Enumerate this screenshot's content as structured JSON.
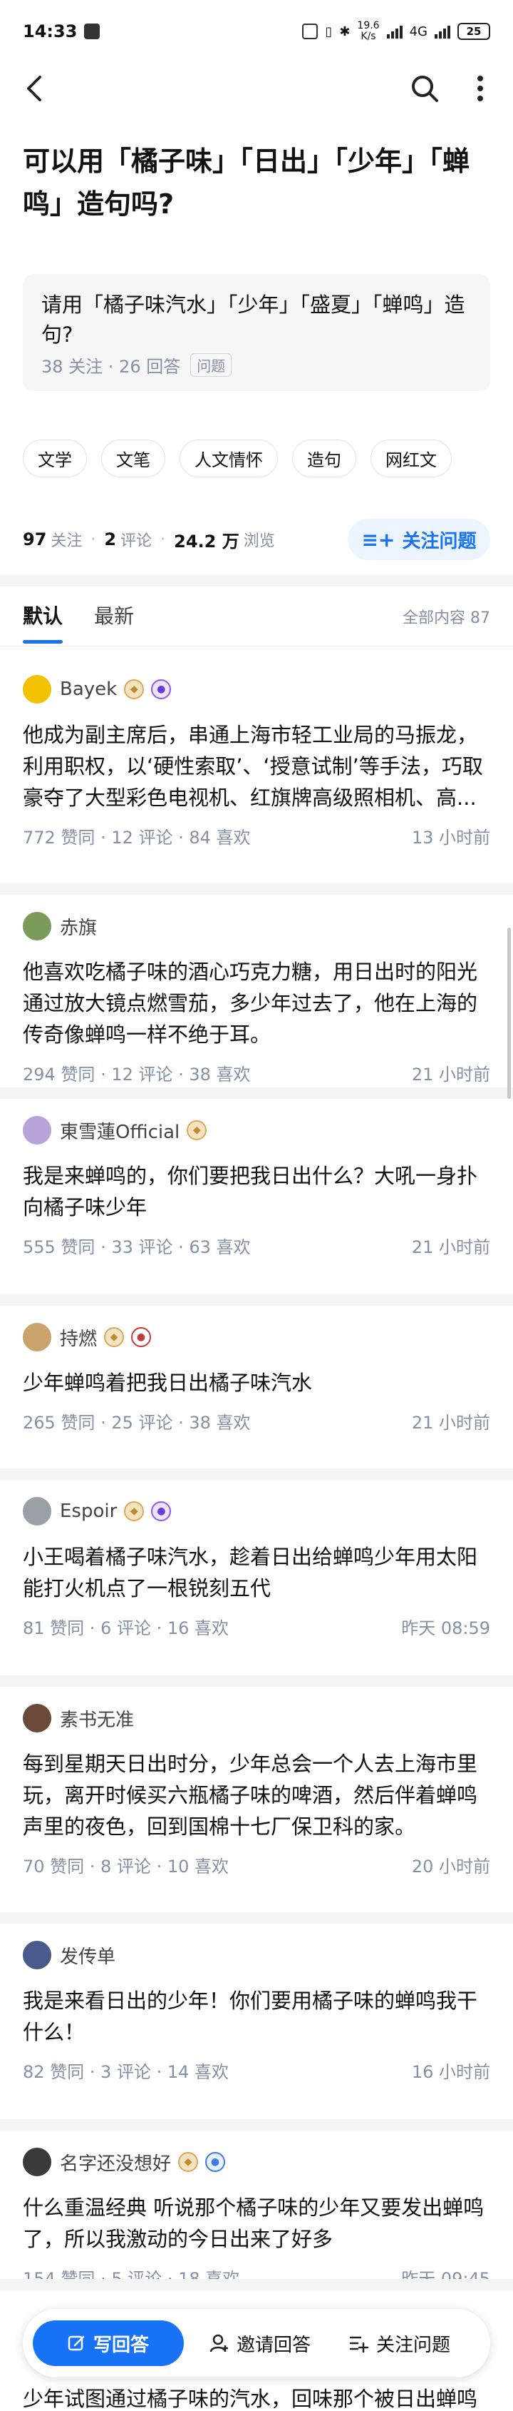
{
  "status_bar": {
    "time": "14:33",
    "net_speed_value": "19.6",
    "net_speed_unit": "K/s",
    "network": "4G",
    "battery": "25"
  },
  "question": {
    "title": "可以用「橘子味」「日出」「少年」「蝉鸣」造句吗?",
    "description": "请用「橘子味汽水」「少年」「盛夏」「蝉鸣」造句?",
    "meta": "38 关注 · 26 回答",
    "tag": "问题",
    "topics": [
      "文学",
      "文笔",
      "人文情怀",
      "造句",
      "网红文"
    ],
    "stats": {
      "follow_count": "97",
      "follow_label": "关注",
      "comment_count": "2",
      "comment_label": "评论",
      "view_count": "24.2 万",
      "view_label": "浏览"
    },
    "follow_button": "关注问题"
  },
  "tabs": {
    "default": "默认",
    "latest": "最新",
    "total": "全部内容 87"
  },
  "answers": [
    {
      "author": "Bayek",
      "text": "他成为副主席后，串通上海市轻工业局的马振龙，利用职权，以‘硬性索取’、‘授意试制’等手法，巧取豪夺了大型彩色电视机、红旗牌高级照相机、高...",
      "meta": "772 赞同 · 12 评论 · 84 喜欢",
      "time": "13 小时前"
    },
    {
      "author": "赤旗",
      "text": "他喜欢吃橘子味的酒心巧克力糖，用日出时的阳光通过放大镜点燃雪茄，多少年过去了，他在上海的传奇像蝉鸣一样不绝于耳。",
      "meta": "294 赞同 · 12 评论 · 38 喜欢",
      "time": "21 小时前"
    },
    {
      "author": "東雪蓮Official",
      "text": "我是来蝉鸣的，你们要把我日出什么？大吼一身扑向橘子味少年",
      "meta": "555 赞同 · 33 评论 · 63 喜欢",
      "time": "21 小时前"
    },
    {
      "author": "持燃",
      "text": "少年蝉鸣着把我日出橘子味汽水",
      "meta": "265 赞同 · 25 评论 · 38 喜欢",
      "time": "21 小时前"
    },
    {
      "author": "Espoir",
      "text": "小王喝着橘子味汽水，趁着日出给蝉鸣少年用太阳能打火机点了一根锐刻五代",
      "meta": "81 赞同 · 6 评论 · 16 喜欢",
      "time": "昨天 08:59"
    },
    {
      "author": "素书无准",
      "text": "每到星期天日出时分，少年总会一个人去上海市里玩，离开时候买六瓶橘子味的啤酒，然后伴着蝉鸣声里的夜色，回到国棉十七厂保卫科的家。",
      "meta": "70 赞同 · 8 评论 · 10 喜欢",
      "time": "20 小时前"
    },
    {
      "author": "发传单",
      "text": "我是来看日出的少年！你们要用橘子味的蝉鸣我干什么！",
      "meta": "82 赞同 · 3 评论 · 14 喜欢",
      "time": "16 小时前"
    },
    {
      "author": "名字还没想好",
      "text": "什么重温经典 听说那个橘子味的少年又要发出蝉鸣了，所以我激动的今日出来了好多",
      "meta": "154 赞同 · 5 评论 · 18 喜欢",
      "time": "昨天 09:45"
    }
  ],
  "peek_text": "少年试图通过橘子味的汽水，回味那个被日出蝉鸣",
  "bottom_bar": {
    "write": "写回答",
    "invite": "邀请回答",
    "follow": "关注问题"
  }
}
